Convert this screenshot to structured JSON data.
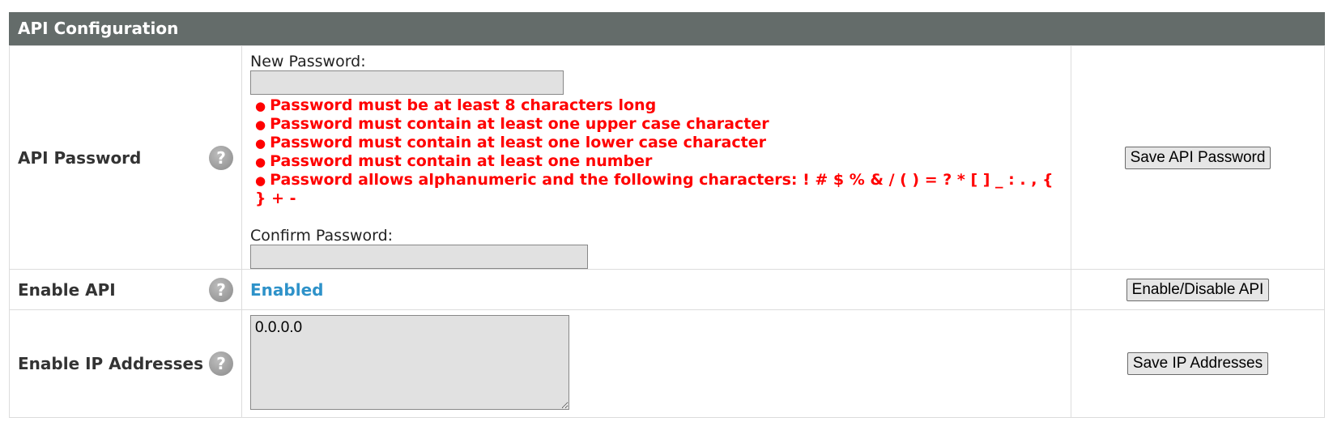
{
  "panel": {
    "title": "API Configuration"
  },
  "password": {
    "label": "API Password",
    "help_icon": "question-icon",
    "new_label": "New Password:",
    "new_value": "",
    "rules": [
      "Password must be at least 8 characters long",
      "Password must contain at least one upper case character",
      "Password must contain at least one lower case character",
      "Password must contain at least one number",
      "Password allows alphanumeric and the following characters: ! # $ % & / ( ) = ? * [ ] _ : . , { } + -"
    ],
    "confirm_label": "Confirm Password:",
    "confirm_value": "",
    "save_button": "Save API Password"
  },
  "api": {
    "label": "Enable API",
    "help_icon": "question-icon",
    "status": "Enabled",
    "status_color": "#2e92c9",
    "toggle_button": "Enable/Disable API"
  },
  "ips": {
    "label": "Enable IP Addresses",
    "help_icon": "question-icon",
    "value": "0.0.0.0",
    "save_button": "Save IP Addresses"
  },
  "colors": {
    "header_bg": "#646c6a",
    "rule_text": "#ff0000"
  }
}
